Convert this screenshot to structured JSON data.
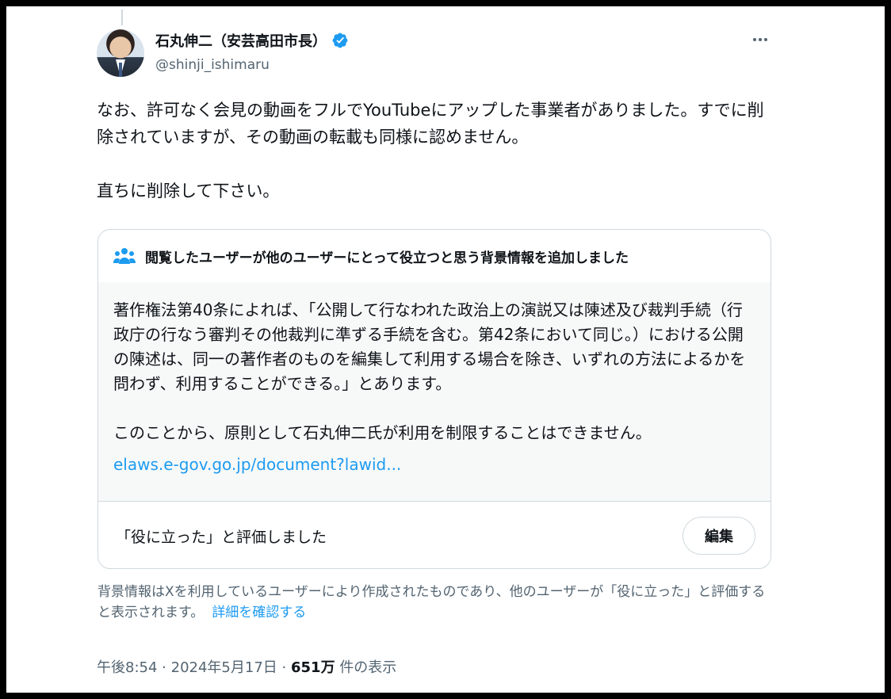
{
  "author": {
    "display_name": "石丸伸二（安芸高田市長）",
    "handle": "@shinji_ishimaru",
    "verified": true
  },
  "tweet": {
    "text": "なお、許可なく会見の動画をフルでYouTubeにアップした事業者がありました。すでに削除されていますが、その動画の転載も同様に認めません。\n\n直ちに削除して下さい。"
  },
  "community_note": {
    "header": "閲覧したユーザーが他のユーザーにとって役立つと思う背景情報を追加しました",
    "body": "著作権法第40条によれば、「公開して行なわれた政治上の演説又は陳述及び裁判手続（行政庁の行なう審判その他裁判に準ずる手続を含む。第42条において同じ。）における公開の陳述は、同一の著作者のものを編集して利用する場合を除き、いずれの方法によるかを問わず、利用することができる。」とあります。\n\nこのことから、原則として石丸伸二氏が利用を制限することはできません。",
    "link_text": "elaws.e-gov.go.jp/document?lawid...",
    "rated_text": "「役に立った」と評価しました",
    "edit_label": "編集"
  },
  "disclaimer": {
    "text": "背景情報はXを利用しているユーザーにより作成されたものであり、他のユーザーが「役に立った」と評価すると表示されます。",
    "link_label": "詳細を確認する"
  },
  "meta": {
    "time": "午後8:54",
    "separator": "·",
    "date": "2024年5月17日",
    "views_count": "651万",
    "views_label": "件の表示"
  },
  "colors": {
    "accent": "#1d9bf0",
    "text_primary": "#0f1419",
    "text_secondary": "#536471",
    "border": "#cfd9de",
    "note_bg": "#f7f9f9"
  },
  "icons": [
    "verified-badge-icon",
    "more-options-icon",
    "people-icon"
  ]
}
